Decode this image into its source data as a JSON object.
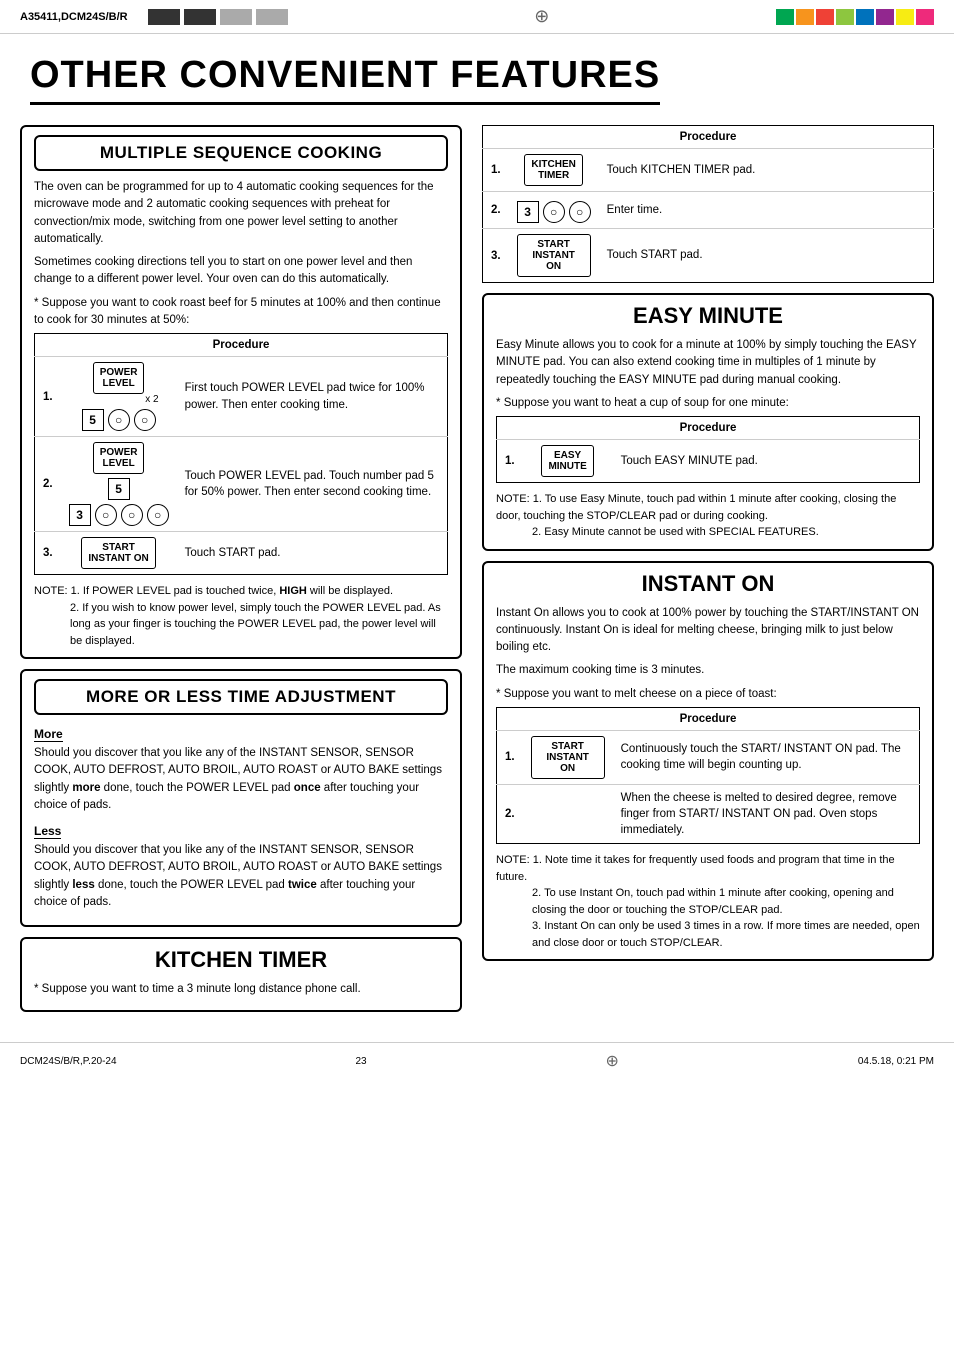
{
  "header": {
    "model": "A35411,DCM24S/B/R",
    "footer_left": "DCM24S/B/R,P.20-24",
    "footer_center": "23",
    "footer_right": "04.5.18, 0:21 PM"
  },
  "page_title": "OTHER CONVENIENT FEATURES",
  "sections": {
    "multiple_sequence": {
      "title": "MULTIPLE SEQUENCE COOKING",
      "body1": "The oven can be programmed for up to 4 automatic cooking sequences for the microwave mode and 2 automatic cooking sequences with preheat for convection/mix mode, switching from one power level setting to another automatically.",
      "body2": "Sometimes cooking directions tell you to start on one power level and then change to a different power level. Your oven can do this automatically.",
      "asterisk": "* Suppose you want to cook roast beef for 5 minutes at 100% and then continue to cook for 30 minutes at 50%:",
      "procedure_label": "Procedure",
      "steps": [
        {
          "num": "1.",
          "pad": "POWER\nLEVEL",
          "x2": "x 2",
          "num_row": [
            "5",
            "○",
            "○"
          ],
          "desc": "First touch POWER LEVEL pad twice for 100% power. Then enter cooking time."
        },
        {
          "num": "2.",
          "pad": "POWER\nLEVEL",
          "num_row2": [
            "5"
          ],
          "num_row3": [
            "3",
            "○",
            "○",
            "○"
          ],
          "desc": "Touch POWER LEVEL pad. Touch number pad 5 for 50% power. Then enter second cooking time."
        },
        {
          "num": "3.",
          "pad": "START\nINSTANT ON",
          "desc": "Touch START pad."
        }
      ],
      "note1": "NOTE: 1. If POWER LEVEL pad is touched twice, HIGH will be displayed.",
      "note2": "2. If you wish to know power level, simply touch the POWER LEVEL pad. As long as your finger is touching the POWER LEVEL pad, the power level will be displayed."
    },
    "more_less": {
      "title": "MORE OR LESS TIME ADJUSTMENT",
      "more_heading": "More",
      "more_body": "Should you discover that you like any of the INSTANT SENSOR, SENSOR COOK, AUTO DEFROST, AUTO BROIL, AUTO ROAST or AUTO BAKE settings slightly more done, touch the POWER LEVEL pad once after touching your choice of pads.",
      "less_heading": "Less",
      "less_body": "Should you discover that you like any of the INSTANT SENSOR, SENSOR COOK, AUTO DEFROST, AUTO BROIL, AUTO ROAST or AUTO BAKE settings slightly less done, touch the POWER LEVEL pad twice after touching your choice of pads."
    },
    "kitchen_timer": {
      "title": "KITCHEN TIMER",
      "asterisk": "* Suppose you want to time a 3 minute long distance phone call.",
      "procedure_label": "Procedure",
      "steps": [
        {
          "num": "1.",
          "pad": "KITCHEN\nTIMER",
          "desc": "Touch KITCHEN TIMER pad."
        },
        {
          "num": "2.",
          "num_row": [
            "3",
            "○",
            "○"
          ],
          "desc": "Enter time."
        },
        {
          "num": "3.",
          "pad": "START\nINSTANT ON",
          "desc": "Touch START pad."
        }
      ]
    },
    "easy_minute": {
      "title": "EASY MINUTE",
      "body1": "Easy Minute allows you to cook for a minute at 100% by simply touching the EASY MINUTE pad. You can also extend cooking time in multiples of 1 minute by repeatedly touching the EASY MINUTE pad during manual cooking.",
      "asterisk": "* Suppose you want to heat a cup of soup for one minute:",
      "procedure_label": "Procedure",
      "steps": [
        {
          "num": "1.",
          "pad": "EASY\nMINUTE",
          "desc": "Touch EASY MINUTE pad."
        }
      ],
      "note1": "NOTE: 1. To use Easy Minute, touch pad within 1 minute after cooking, closing the door, touching the STOP/CLEAR pad or during cooking.",
      "note2": "2. Easy Minute cannot be used with SPECIAL FEATURES."
    },
    "instant_on": {
      "title": "INSTANT ON",
      "body1": "Instant On allows you to cook at 100% power by touching the START/INSTANT ON continuously. Instant On is ideal for melting cheese, bringing milk to just below boiling etc.",
      "body2": "The maximum cooking time is 3 minutes.",
      "asterisk": "* Suppose you want to melt cheese on a piece of toast:",
      "procedure_label": "Procedure",
      "steps": [
        {
          "num": "1.",
          "pad": "START\nINSTANT ON",
          "desc": "Continuously touch the START/ INSTANT ON pad. The cooking time will begin counting up."
        },
        {
          "num": "2.",
          "desc": "When the cheese is melted to desired degree, remove finger from START/ INSTANT ON pad. Oven stops immediately."
        }
      ],
      "note1": "NOTE: 1. Note time it takes for frequently used foods and program that time in the future.",
      "note2": "2. To use Instant On, touch pad within 1 minute after cooking, opening and closing the door or touching the STOP/CLEAR pad.",
      "note3": "3. Instant On can only be used 3 times in a row. If more times are needed, open and close door or touch STOP/CLEAR."
    }
  }
}
